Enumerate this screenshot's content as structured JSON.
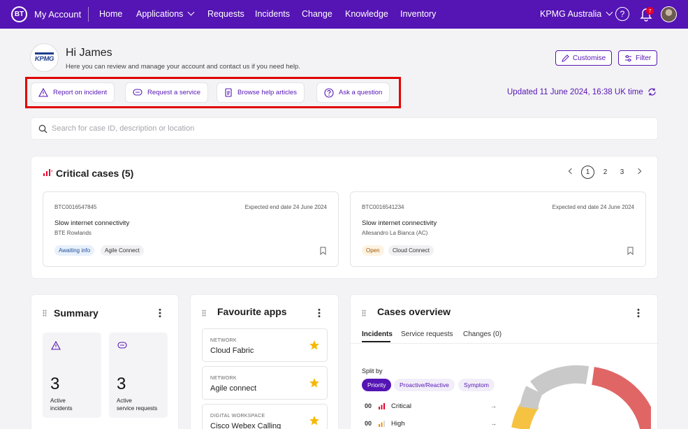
{
  "nav": {
    "logo": "BT",
    "brand": "My Account",
    "items": [
      "Home",
      "Applications",
      "Requests",
      "Incidents",
      "Change",
      "Knowledge",
      "Inventory"
    ],
    "org": "KPMG Australia",
    "help": "?",
    "notifications": "7"
  },
  "header": {
    "logo_text": "KPMG",
    "greeting": "Hi James",
    "subtitle": "Here you can review and manage your account and contact us if you need help.",
    "customise": "Customise",
    "filter": "Filter"
  },
  "actions": {
    "report": "Report on incident",
    "request": "Request a service",
    "browse": "Browse help articles",
    "ask": "Ask a question",
    "updated": "Updated 11 June 2024, 16:38 UK time"
  },
  "search": {
    "placeholder": "Search for case ID, description or location"
  },
  "critical": {
    "title": "Critical cases (5)",
    "pages": [
      "1",
      "2",
      "3"
    ],
    "cards": [
      {
        "id": "BTC0016547845",
        "date": "Expected end date 24 June 2024",
        "title": "Slow internet connectivity",
        "sub": "BTE Rowlands",
        "status": "Awaiting info",
        "tag": "Agile Connect"
      },
      {
        "id": "BTC0016541234",
        "date": "Expected end date 24 June 2024",
        "title": "Slow internet connectivity",
        "sub": "Allesandro La Bianca (AC)",
        "status": "Open",
        "tag": "Cloud Connect"
      }
    ]
  },
  "summary": {
    "title": "Summary",
    "stats": [
      {
        "num": "3",
        "line1": "Active",
        "line2": "incidents"
      },
      {
        "num": "3",
        "line1": "Active",
        "line2": "service requests"
      }
    ]
  },
  "favourites": {
    "title": "Favourite apps",
    "apps": [
      {
        "cat": "NETWORK",
        "name": "Cloud Fabric"
      },
      {
        "cat": "NETWORK",
        "name": "Agile connect"
      },
      {
        "cat": "DIGITAL WORKSPACE",
        "name": "Cisco Webex Calling"
      }
    ]
  },
  "overview": {
    "title": "Cases overview",
    "tabs": [
      "Incidents",
      "Service requests",
      "Changes (0)"
    ],
    "split_label": "Split by",
    "pills": [
      "Priority",
      "Proactive/Reactive",
      "Symptom"
    ],
    "rows": [
      {
        "num": "00",
        "label": "Critical"
      },
      {
        "num": "00",
        "label": "High"
      }
    ],
    "arrow": "→"
  },
  "colors": {
    "brand": "#5514b4",
    "critical": "#e06666",
    "high": "#f5c242",
    "grey": "#c9c9c9",
    "highlight": "#e00000"
  }
}
